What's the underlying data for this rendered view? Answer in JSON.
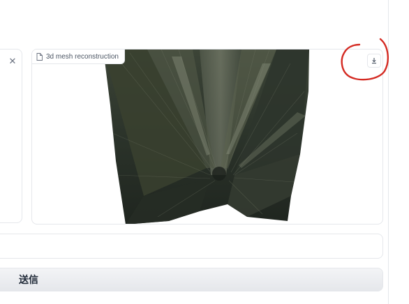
{
  "output": {
    "label": "3d mesh reconstruction",
    "label_icon": "file-icon",
    "download_icon": "download-icon"
  },
  "left_panel": {
    "close_icon": "close-icon",
    "close_glyph": "✕"
  },
  "textbox": {
    "value": ""
  },
  "submit": {
    "label": "送信"
  },
  "annotation": {
    "color": "#d42a22",
    "shape": "hand-drawn circle"
  }
}
